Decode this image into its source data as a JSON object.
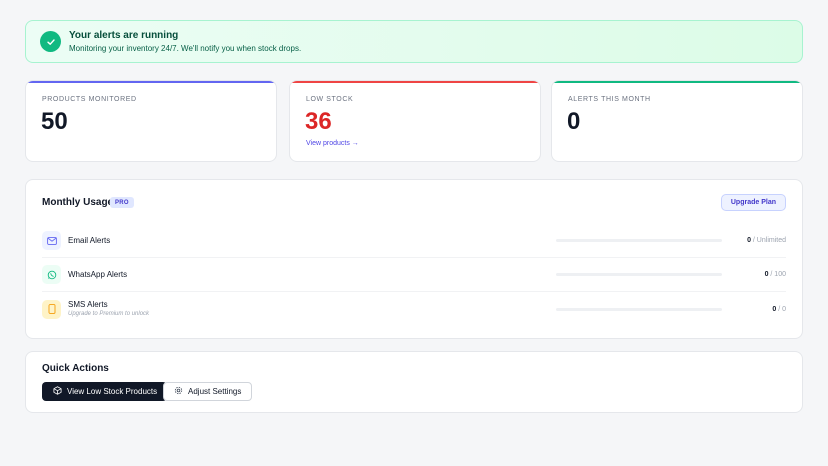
{
  "banner": {
    "icon": "check-icon",
    "title": "Your alerts are running",
    "subtitle": "Monitoring your inventory 24/7. We'll notify you when stock drops."
  },
  "stats": [
    {
      "label": "PRODUCTS MONITORED",
      "value": "50",
      "accent": "#6366f1",
      "value_color": "#111827"
    },
    {
      "label": "LOW STOCK",
      "value": "36",
      "accent": "#ef4444",
      "value_color": "#dc2626",
      "link": "View products →"
    },
    {
      "label": "ALERTS THIS MONTH",
      "value": "0",
      "accent": "#10b981",
      "value_color": "#111827"
    }
  ],
  "usage": {
    "title": "Monthly Usage",
    "badge": "PRO",
    "upgrade_label": "Upgrade Plan",
    "rows": [
      {
        "icon": "mail-icon",
        "name": "Email Alerts",
        "used": "0",
        "limit": "/ Unlimited",
        "note": "",
        "progress": 0
      },
      {
        "icon": "whatsapp-icon",
        "name": "WhatsApp Alerts",
        "used": "0",
        "limit": "/ 100",
        "note": "",
        "progress": 0
      },
      {
        "icon": "phone-icon",
        "name": "SMS Alerts",
        "used": "0",
        "limit": "/ 0",
        "note": "Upgrade to Premium to unlock",
        "progress": 0
      }
    ]
  },
  "quick_actions": {
    "title": "Quick Actions",
    "primary_label": "View Low Stock Products",
    "primary_icon": "box-icon",
    "secondary_label": "Adjust Settings",
    "secondary_icon": "gear-icon"
  },
  "colors": {
    "success": "#10b981",
    "primary": "#4f46e5",
    "danger": "#dc2626",
    "dark": "#111827"
  }
}
